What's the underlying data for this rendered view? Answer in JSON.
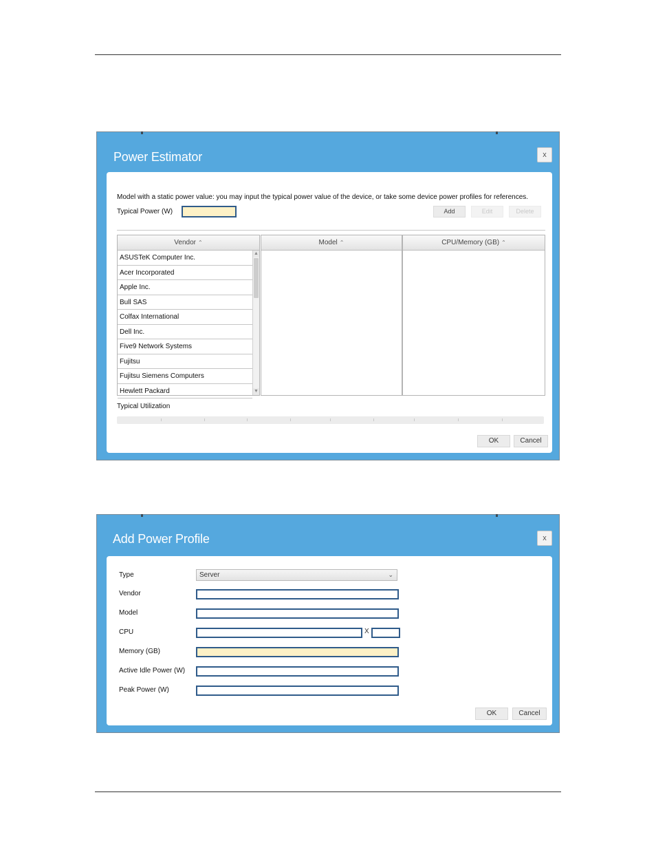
{
  "power_estimator": {
    "title": "Power Estimator",
    "close_label": "x",
    "info_text": "Model with a static power value: you may input the typical power value of the device, or take some device power profiles for references.",
    "typical_power_label": "Typical Power (W)",
    "typical_power_value": "",
    "buttons": {
      "add": "Add",
      "edit": "Edit",
      "delete": "Delete"
    },
    "columns": {
      "vendor": "Vendor",
      "model": "Model",
      "cpu_memory": "CPU/Memory (GB)"
    },
    "sort_icon": "caret-up-icon",
    "vendors": [
      "ASUSTeK Computer Inc.",
      "Acer Incorporated",
      "Apple Inc.",
      "Bull SAS",
      "Colfax International",
      "Dell Inc.",
      "Five9 Network Systems",
      "Fujitsu",
      "Fujitsu Siemens Computers",
      "Hewlett Packard"
    ],
    "typical_utilization_label": "Typical Utilization",
    "ok_label": "OK",
    "cancel_label": "Cancel"
  },
  "add_power_profile": {
    "title": "Add Power Profile",
    "close_label": "x",
    "type_label": "Type",
    "type_value": "Server",
    "vendor_label": "Vendor",
    "model_label": "Model",
    "cpu_label": "CPU",
    "cpu_multiplier": "X",
    "memory_label": "Memory (GB)",
    "active_idle_label": "Active Idle Power (W)",
    "peak_power_label": "Peak Power (W)",
    "ok_label": "OK",
    "cancel_label": "Cancel"
  },
  "colors": {
    "dialog_frame": "#55a8de",
    "input_highlight": "#fdf1c6",
    "input_border": "#2f5b8a"
  }
}
